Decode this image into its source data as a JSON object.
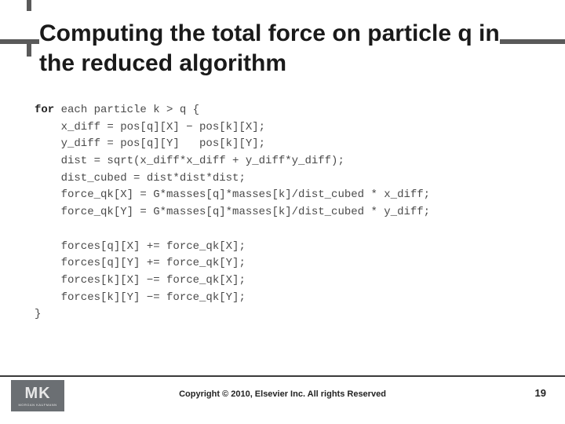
{
  "title": {
    "line1": "Computing the total force on particle q in",
    "line2": "the reduced algorithm"
  },
  "code": {
    "keyword": "for",
    "rest": " each particle k > q {\n    x_diff = pos[q][X] − pos[k][X];\n    y_diff = pos[q][Y]   pos[k][Y];\n    dist = sqrt(x_diff*x_diff + y_diff*y_diff);\n    dist_cubed = dist*dist*dist;\n    force_qk[X] = G*masses[q]*masses[k]/dist_cubed * x_diff;\n    force_qk[Y] = G*masses[q]*masses[k]/dist_cubed * y_diff;\n\n    forces[q][X] += force_qk[X];\n    forces[q][Y] += force_qk[Y];\n    forces[k][X] −= force_qk[X];\n    forces[k][Y] −= force_qk[Y];\n}"
  },
  "footer": {
    "logo_main": "MK",
    "logo_sub": "MORGAN KAUFMANN",
    "copyright": "Copyright © 2010, Elsevier Inc. All rights Reserved",
    "page": "19"
  }
}
